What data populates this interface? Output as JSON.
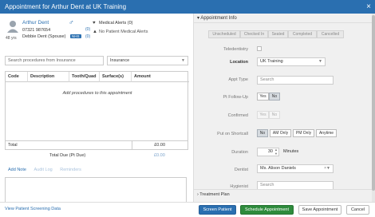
{
  "dialog": {
    "title": "Appointment for Arthur Dent at UK Training",
    "close_glyph": "×"
  },
  "patient": {
    "name": "Arthur Dent",
    "gender_symbol": "♂",
    "phone": "07321 987654",
    "relationship": "Debbie Dent (Spouse)",
    "age": "48 yrs",
    "nhs_badge": "NHS",
    "count_1": "(0)",
    "count_2": "(0)",
    "medical_alerts": "Medical Alerts (0)",
    "patient_medical_alerts": "No Patient Medical Alerts"
  },
  "procedures": {
    "search_placeholder": "Search procedures from Insurance",
    "payment_type": "Insurance",
    "columns": [
      "Code",
      "Description",
      "Tooth/Quad",
      "Surface(s)",
      "Amount"
    ],
    "empty_text": "Add procedures to this appointment",
    "total_label": "Total",
    "total_value": "£0.00",
    "due_label": "Total Due (Pt Due)",
    "due_value": "£0.00"
  },
  "notes_tabs": [
    "Add Note",
    "Audit Log",
    "Reminders"
  ],
  "appointment_info": {
    "header": "Appointment Info",
    "statuses": [
      "Unscheduled",
      "Checked In",
      "Seated",
      "Completed",
      "Cancelled"
    ],
    "teledentistry_label": "Teledentistry",
    "location_label": "Location",
    "location_value": "UK Training",
    "appt_type_label": "Appt Type",
    "appt_type_placeholder": "Search",
    "pt_followup_label": "Pt Follow-Up",
    "yes": "Yes",
    "no": "No",
    "confirmed_label": "Confirmed",
    "shortcall_label": "Put on Shortcall",
    "shortcall_options": [
      "No",
      "AM Only",
      "PM Only",
      "Anytime"
    ],
    "duration_label": "Duration",
    "duration_value": "30",
    "duration_unit": "Minutes",
    "dentist_label": "Dentist",
    "dentist_value": "Ms. Alison Daniels",
    "hygienist_label": "Hygienist",
    "hygienist_placeholder": "Search",
    "treatment_plan": "Treatment Plan"
  },
  "footer": {
    "screening_link": "View Patient Screening Data",
    "screen_patient": "Screen Patient",
    "schedule": "Schedule Appointment",
    "save": "Save Appointment",
    "cancel": "Cancel"
  }
}
